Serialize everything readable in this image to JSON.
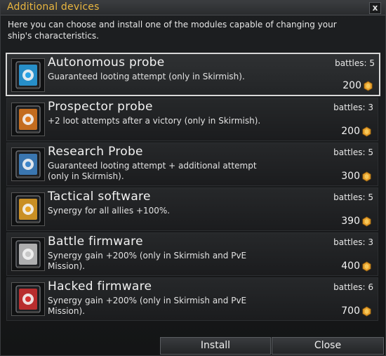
{
  "dialog": {
    "title": "Additional devices",
    "close_glyph": "x",
    "intro": "Here you can choose and install one of the modules capable of changing your ship's characteristics."
  },
  "items": [
    {
      "name": "Autonomous probe",
      "desc": "Guaranteed looting attempt (only in Skirmish).",
      "battles": "battles: 5",
      "price": "200",
      "icon": "autonomous-probe-icon",
      "selected": true,
      "accent": "#29a3e6"
    },
    {
      "name": "Prospector probe",
      "desc": "+2 loot attempts after a victory (only in Skirmish).",
      "battles": "battles: 3",
      "price": "200",
      "icon": "prospector-probe-icon",
      "selected": false,
      "accent": "#e07a1f"
    },
    {
      "name": "Research Probe",
      "desc": "Guaranteed looting attempt + additional attempt (only in Skirmish).",
      "battles": "battles: 5",
      "price": "300",
      "icon": "research-probe-icon",
      "selected": false,
      "accent": "#3f86c9"
    },
    {
      "name": "Tactical software",
      "desc": "Synergy for all allies +100%.",
      "battles": "battles: 5",
      "price": "390",
      "icon": "tactical-software-icon",
      "selected": false,
      "accent": "#e8a325"
    },
    {
      "name": "Battle firmware",
      "desc": "Synergy gain +200% (only in Skirmish and PvE Mission).",
      "battles": "battles: 3",
      "price": "400",
      "icon": "battle-firmware-icon",
      "selected": false,
      "accent": "#c8c8c8"
    },
    {
      "name": "Hacked firmware",
      "desc": "Synergy gain +200% (only in Skirmish and PvE Mission).",
      "battles": "battles: 6",
      "price": "700",
      "icon": "hacked-firmware-icon",
      "selected": false,
      "accent": "#d43030"
    }
  ],
  "buttons": {
    "install": "Install",
    "close": "Close"
  },
  "colors": {
    "title": "#e9b640",
    "coin": "#e8a02c"
  }
}
